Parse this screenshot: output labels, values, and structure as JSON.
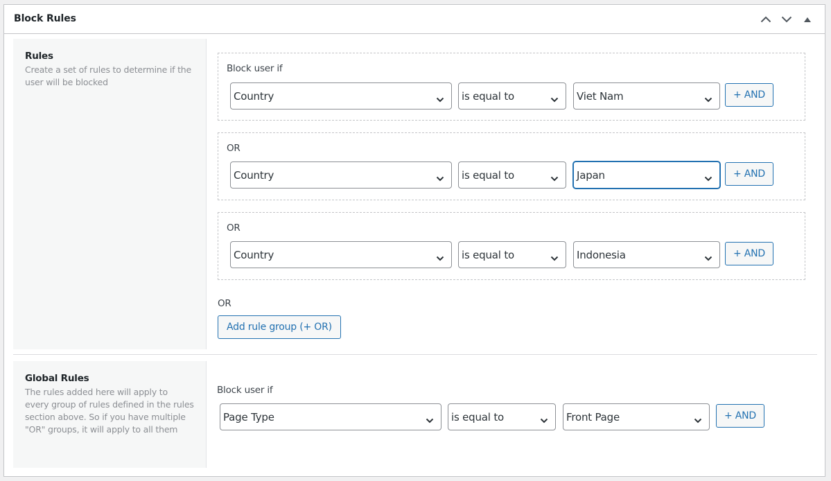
{
  "panel": {
    "title": "Block Rules",
    "controls": {
      "move_up": "chevron-up-icon",
      "move_down": "chevron-down-icon",
      "toggle": "triangle-up-icon"
    }
  },
  "rules_section": {
    "title": "Rules",
    "description": "Create a set of rules to determine if the user will be blocked",
    "groups": [
      {
        "label": "Block user if",
        "rules": [
          {
            "field": "Country",
            "operator": "is equal to",
            "value": "Viet Nam",
            "and_label": "+ AND"
          }
        ]
      },
      {
        "label": "OR",
        "rules": [
          {
            "field": "Country",
            "operator": "is equal to",
            "value": "Japan",
            "and_label": "+ AND",
            "focused": true
          }
        ]
      },
      {
        "label": "OR",
        "rules": [
          {
            "field": "Country",
            "operator": "is equal to",
            "value": "Indonesia",
            "and_label": "+ AND"
          }
        ]
      }
    ],
    "or_label": "OR",
    "add_group_label": "Add rule group (+ OR)"
  },
  "global_section": {
    "title": "Global Rules",
    "description": "The rules added here will apply to every group of rules defined in the rules section above. So if you have multiple \"OR\" groups, it will apply to all them",
    "group": {
      "label": "Block user if",
      "rules": [
        {
          "field": "Page Type",
          "operator": "is equal to",
          "value": "Front Page",
          "and_label": "+ AND"
        }
      ]
    }
  },
  "colors": {
    "accent": "#2271b1",
    "border": "#c3c4c7",
    "label_bg": "#f6f7f7",
    "muted_text": "#8c8f94"
  }
}
